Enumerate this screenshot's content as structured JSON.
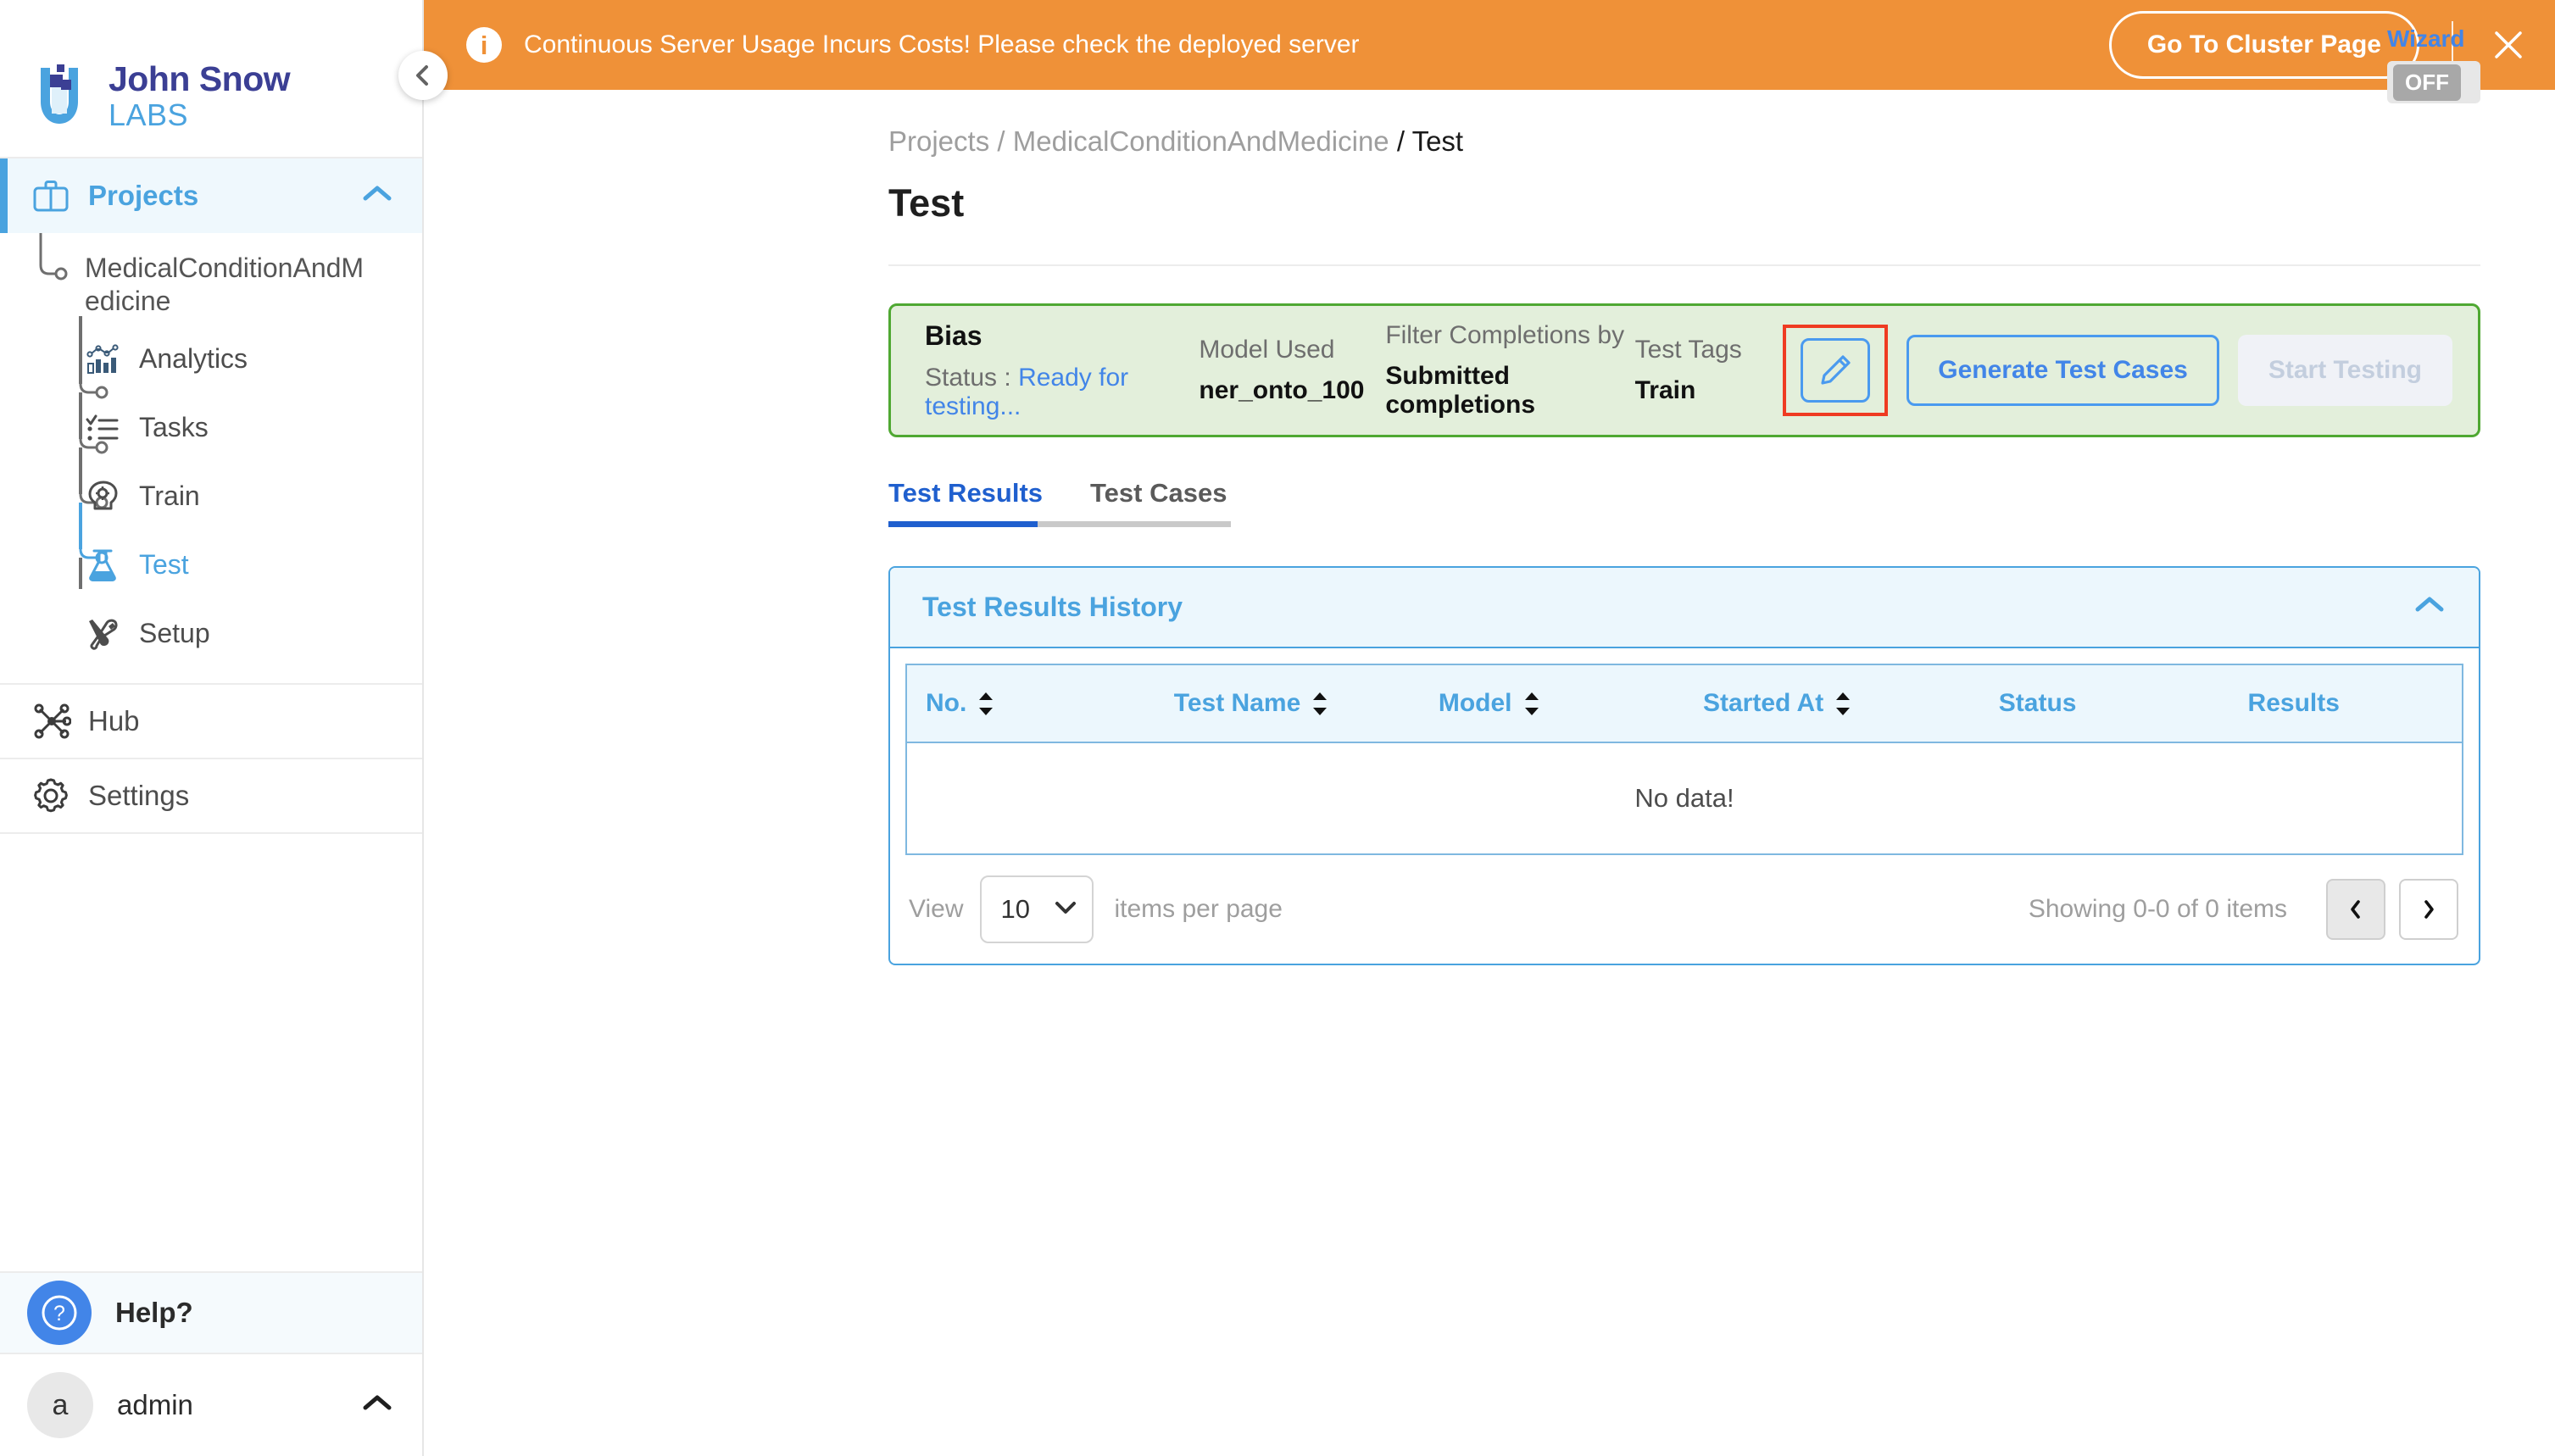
{
  "brand": {
    "name_top": "John Snow",
    "name_bottom": "LABS"
  },
  "banner": {
    "message": "Continuous Server Usage Incurs Costs! Please check the deployed server",
    "info_glyph": "i",
    "cluster_button": "Go To Cluster Page"
  },
  "sidebar": {
    "projects": {
      "label": "Projects"
    },
    "project_name": "MedicalConditionAndMedicine",
    "items": [
      {
        "label": "Analytics",
        "icon": "analytics-icon",
        "active": false
      },
      {
        "label": "Tasks",
        "icon": "tasks-icon",
        "active": false
      },
      {
        "label": "Train",
        "icon": "train-icon",
        "active": false
      },
      {
        "label": "Test",
        "icon": "test-flask-icon",
        "active": true
      },
      {
        "label": "Setup",
        "icon": "setup-tools-icon",
        "active": false
      }
    ],
    "hub": "Hub",
    "settings": "Settings",
    "help": "Help?",
    "user": {
      "initial": "a",
      "name": "admin"
    }
  },
  "breadcrumb": {
    "root": "Projects",
    "sep1": " / ",
    "project": "MedicalConditionAndMedicine",
    "sep2": " / ",
    "current": "Test"
  },
  "page": {
    "title": "Test"
  },
  "wizard": {
    "label": "Wizard",
    "state": "OFF"
  },
  "info_card": {
    "test_type": "Bias",
    "status_label": "Status : ",
    "status_value": "Ready for testing...",
    "model_used_label": "Model Used",
    "model_used_value": "ner_onto_100",
    "filter_label": "Filter Completions by",
    "filter_value": "Submitted completions",
    "tags_label": "Test Tags",
    "tags_value": "Train",
    "generate_button": "Generate Test Cases",
    "start_button": "Start Testing"
  },
  "tabs": [
    {
      "label": "Test Results",
      "active": true
    },
    {
      "label": "Test Cases",
      "active": false
    }
  ],
  "panel": {
    "title": "Test Results History",
    "columns": [
      {
        "label": "No.",
        "sortable": true
      },
      {
        "label": "Test Name",
        "sortable": true
      },
      {
        "label": "Model",
        "sortable": true
      },
      {
        "label": "Started At",
        "sortable": true
      },
      {
        "label": "Status",
        "sortable": false
      },
      {
        "label": "Results",
        "sortable": false
      }
    ],
    "empty_message": "No data!"
  },
  "pagination": {
    "view_label": "View",
    "per_page_value": "10",
    "per_page_suffix": "items per page",
    "showing": "Showing 0-0 of 0 items"
  },
  "colors": {
    "brand_blue": "#4aa3df",
    "brand_purple": "#3b3f94",
    "banner_orange": "#ef9138",
    "card_green_bg": "#e3efdb",
    "card_green_border": "#4fa832",
    "accent_blue": "#4285e8",
    "highlight_red": "#ef3b22"
  }
}
